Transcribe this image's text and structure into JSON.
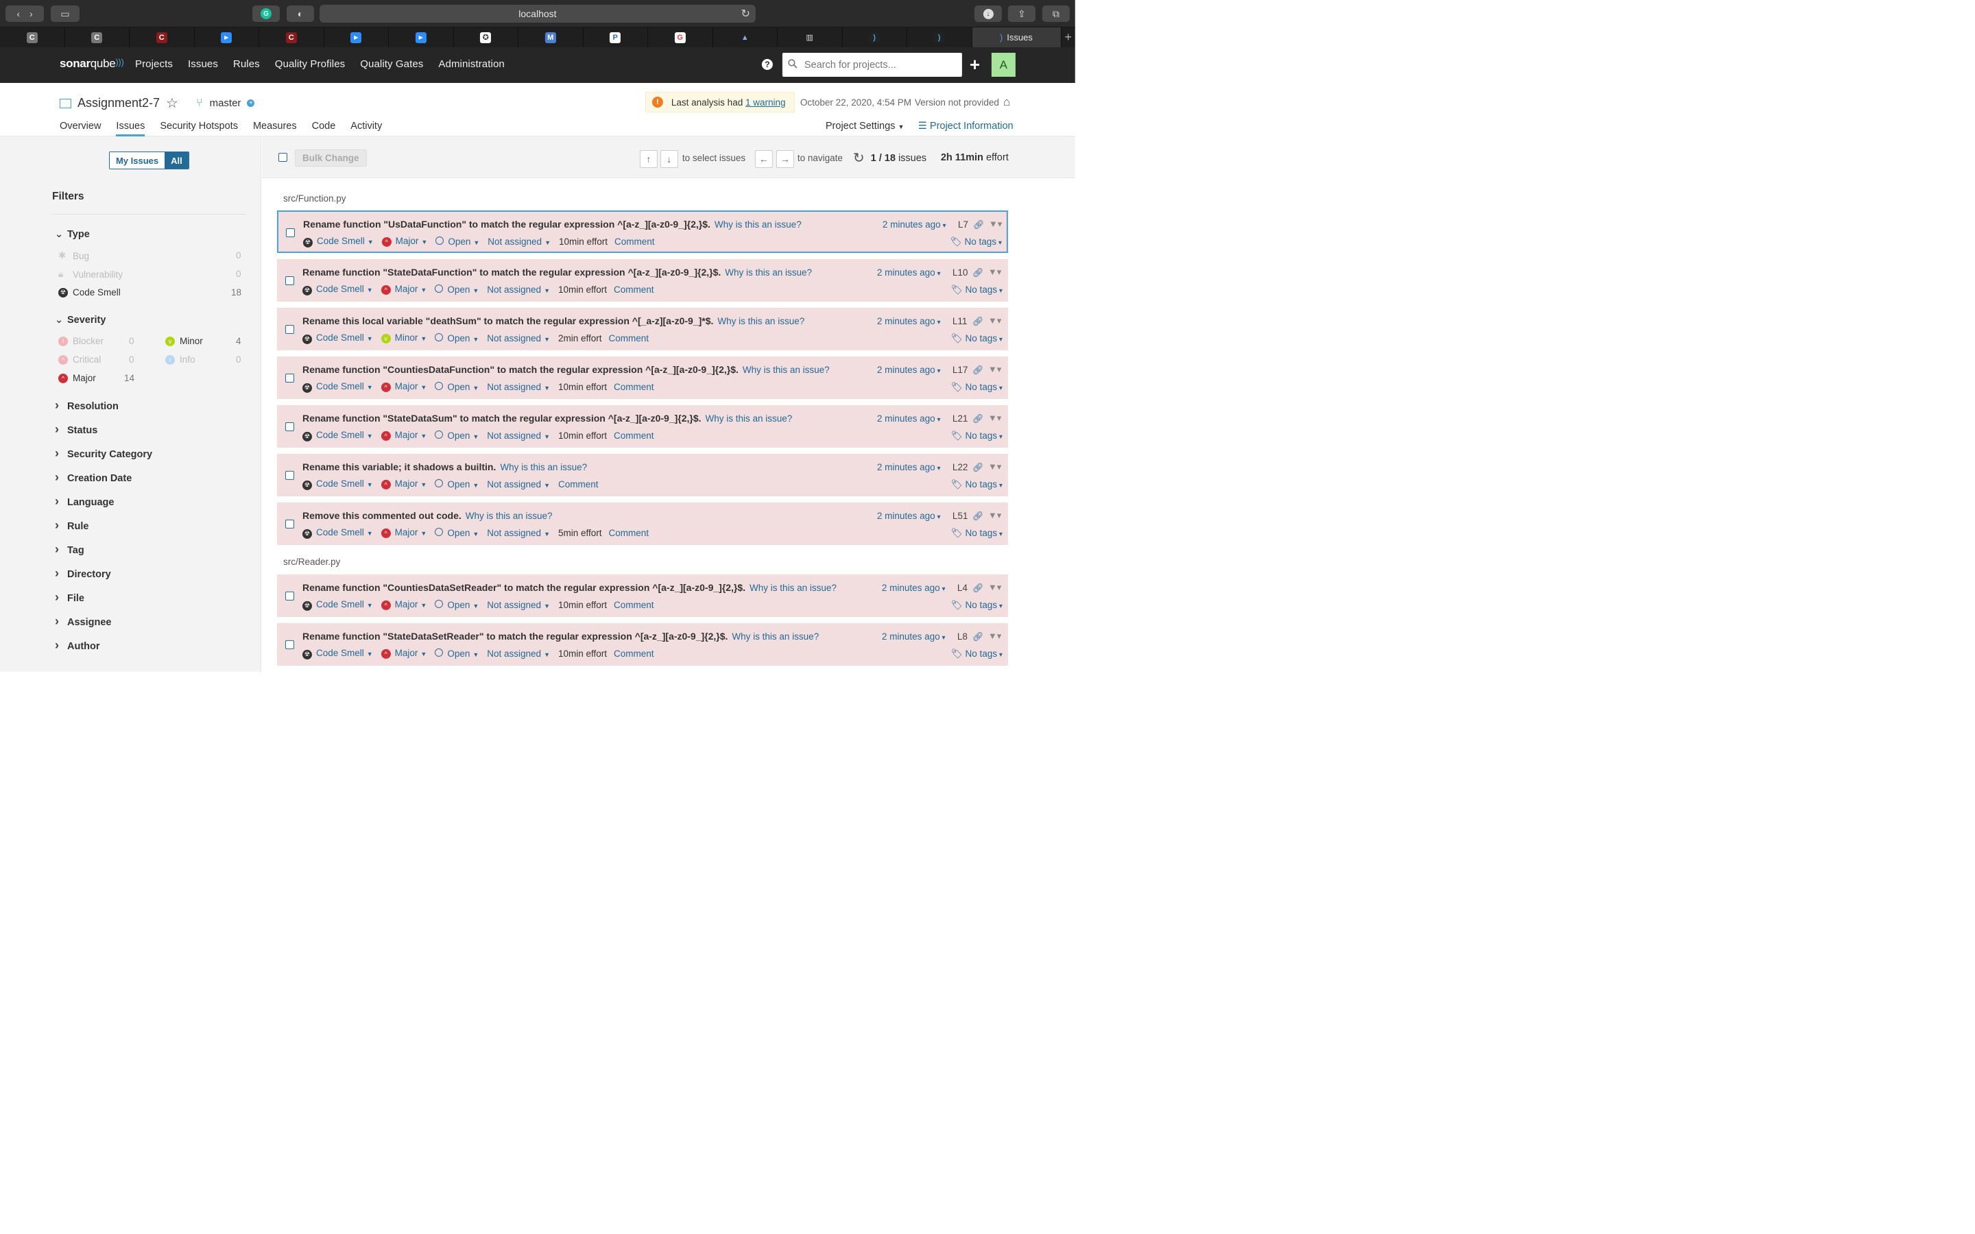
{
  "browser": {
    "url": "localhost",
    "active_tab": "Issues",
    "tab_favicons": [
      "C",
      "C",
      "C",
      "cam",
      "C",
      "cam",
      "cam",
      "gear",
      "M",
      "P",
      "G",
      "A",
      "grid",
      "sq",
      "sq"
    ]
  },
  "nav": {
    "logo_a": "sonar",
    "logo_b": "qube",
    "links": [
      "Projects",
      "Issues",
      "Rules",
      "Quality Profiles",
      "Quality Gates",
      "Administration"
    ],
    "search_placeholder": "Search for projects...",
    "avatar": "A"
  },
  "project": {
    "name": "Assignment2-7",
    "branch": "master",
    "warning_text": "Last analysis had ",
    "warning_link": "1 warning",
    "date": "October 22, 2020, 4:54 PM",
    "version": "Version not provided",
    "tabs": [
      "Overview",
      "Issues",
      "Security Hotspots",
      "Measures",
      "Code",
      "Activity"
    ],
    "settings": "Project Settings",
    "info": "Project Information"
  },
  "sidebar": {
    "my_issues": "My Issues",
    "all": "All",
    "filters_title": "Filters",
    "type_title": "Type",
    "types": [
      {
        "label": "Bug",
        "count": "0"
      },
      {
        "label": "Vulnerability",
        "count": "0"
      },
      {
        "label": "Code Smell",
        "count": "18"
      }
    ],
    "severity_title": "Severity",
    "severities": [
      {
        "label": "Blocker",
        "count": "0"
      },
      {
        "label": "Critical",
        "count": "0"
      },
      {
        "label": "Major",
        "count": "14"
      },
      {
        "label": "Minor",
        "count": "4"
      },
      {
        "label": "Info",
        "count": "0"
      }
    ],
    "collapsed": [
      "Resolution",
      "Status",
      "Security Category",
      "Creation Date",
      "Language",
      "Rule",
      "Tag",
      "Directory",
      "File",
      "Assignee",
      "Author"
    ]
  },
  "toolbar": {
    "bulk_change": "Bulk Change",
    "up": "↑",
    "down": "↓",
    "select_text": "to select issues",
    "left": "←",
    "right": "→",
    "navigate_text": "to navigate",
    "position": "1 / 18",
    "issues_word": " issues",
    "effort_value": "2h 11min",
    "effort_word": " effort"
  },
  "files": [
    {
      "name": "src/Function.py"
    },
    {
      "name": "src/Reader.py"
    }
  ],
  "common": {
    "why": "Why is this an issue?",
    "type": "Code Smell",
    "status": "Open",
    "assignee": "Not assigned",
    "comment": "Comment",
    "no_tags": "No tags",
    "time": "2 minutes ago"
  },
  "issues": [
    {
      "msg": "Rename function \"UsDataFunction\" to match the regular expression ^[a-z_][a-z0-9_]{2,}$.",
      "severity": "Major",
      "effort": "10min effort",
      "line": "L7"
    },
    {
      "msg": "Rename function \"StateDataFunction\" to match the regular expression ^[a-z_][a-z0-9_]{2,}$.",
      "severity": "Major",
      "effort": "10min effort",
      "line": "L10"
    },
    {
      "msg": "Rename this local variable \"deathSum\" to match the regular expression ^[_a-z][a-z0-9_]*$.",
      "severity": "Minor",
      "effort": "2min effort",
      "line": "L11"
    },
    {
      "msg": "Rename function \"CountiesDataFunction\" to match the regular expression ^[a-z_][a-z0-9_]{2,}$.",
      "severity": "Major",
      "effort": "10min effort",
      "line": "L17"
    },
    {
      "msg": "Rename function \"StateDataSum\" to match the regular expression ^[a-z_][a-z0-9_]{2,}$.",
      "severity": "Major",
      "effort": "10min effort",
      "line": "L21"
    },
    {
      "msg": "Rename this variable; it shadows a builtin.",
      "severity": "Major",
      "effort": "",
      "line": "L22"
    },
    {
      "msg": "Remove this commented out code.",
      "severity": "Major",
      "effort": "5min effort",
      "line": "L51"
    },
    {
      "msg": "Rename function \"CountiesDataSetReader\" to match the regular expression ^[a-z_][a-z0-9_]{2,}$.",
      "severity": "Major",
      "effort": "10min effort",
      "line": "L4"
    },
    {
      "msg": "Rename function \"StateDataSetReader\" to match the regular expression ^[a-z_][a-z0-9_]{2,}$.",
      "severity": "Major",
      "effort": "10min effort",
      "line": "L8"
    }
  ],
  "colors": {
    "accent": "#236a97",
    "issue_bg": "#f2dede",
    "major": "#d02f3a",
    "minor": "#b0d513",
    "nav_bg": "#262626"
  }
}
